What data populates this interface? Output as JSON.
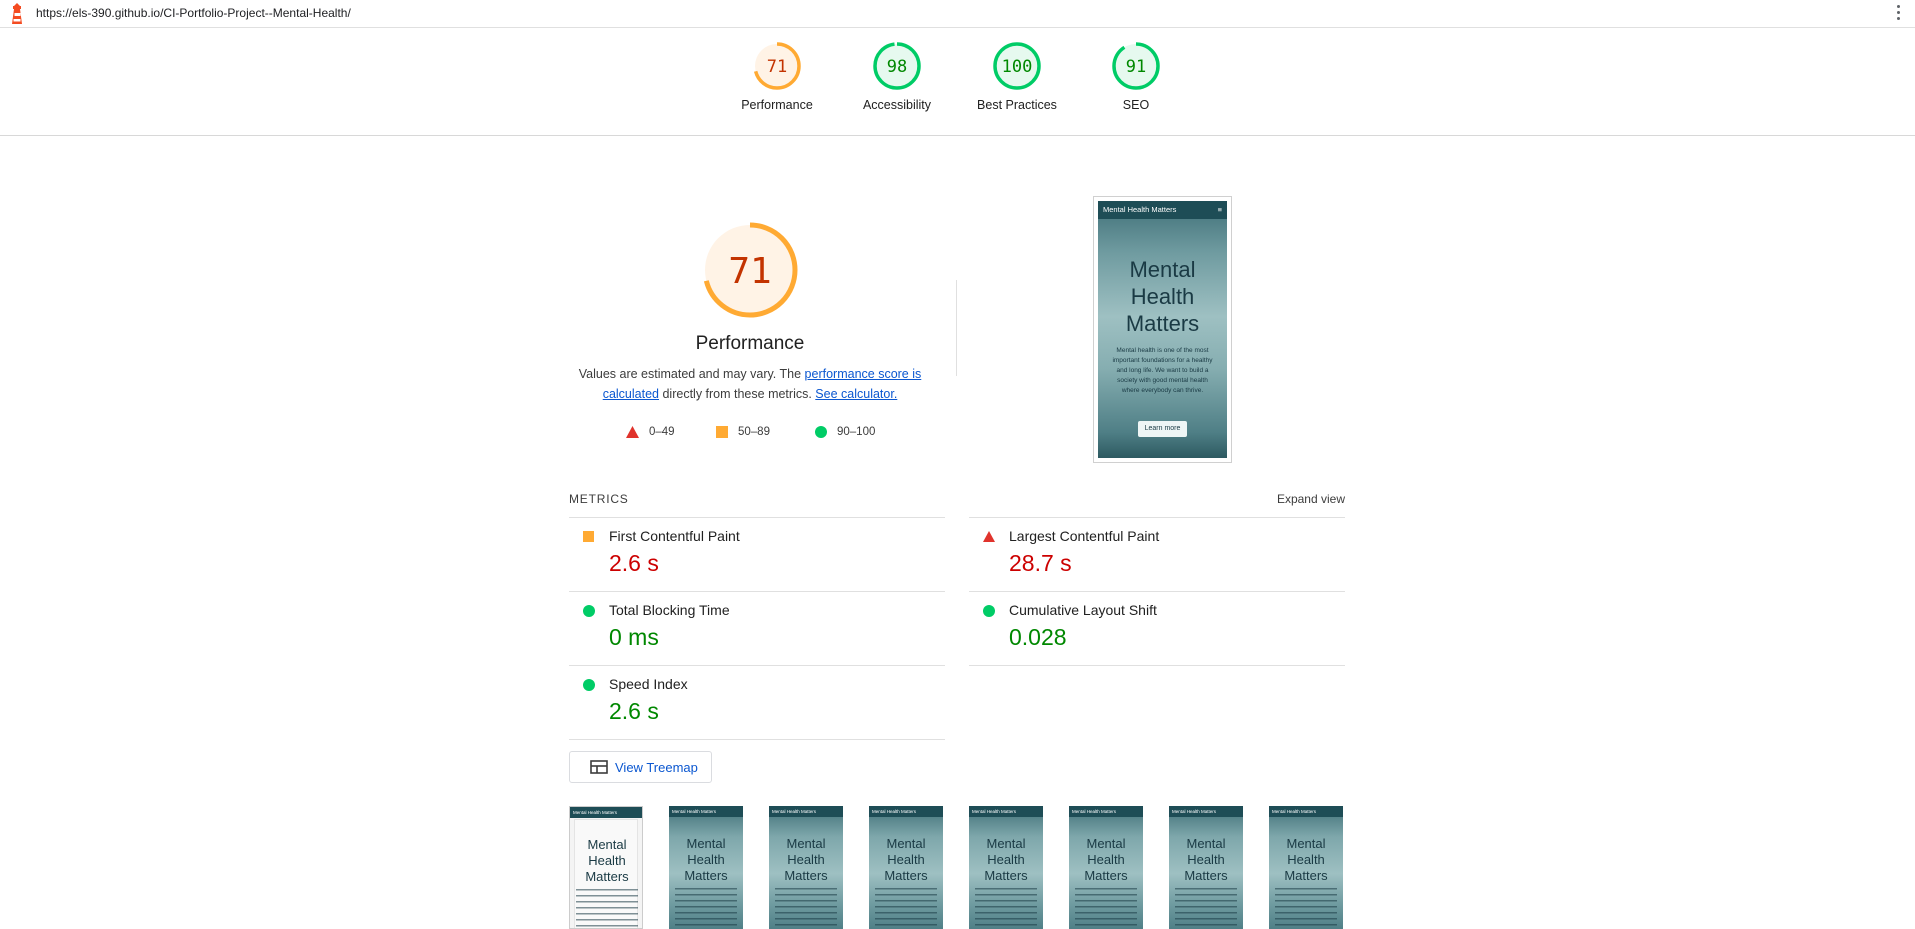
{
  "browser": {
    "url": "https://els-390.github.io/CI-Portfolio-Project--Mental-Health/"
  },
  "categories": [
    {
      "name": "Performance",
      "score": "71",
      "color": "#fa3",
      "text_color": "#c33300"
    },
    {
      "name": "Accessibility",
      "score": "98",
      "color": "#0c6",
      "text_color": "#080"
    },
    {
      "name": "Best Practices",
      "score": "100",
      "color": "#0c6",
      "text_color": "#080"
    },
    {
      "name": "SEO",
      "score": "91",
      "color": "#0c6",
      "text_color": "#080"
    }
  ],
  "performance": {
    "score": "71",
    "title": "Performance",
    "desc_prefix": "Values are estimated and may vary. The ",
    "desc_link1": "performance score is calculated",
    "desc_middle": " directly from these metrics. ",
    "desc_link2": "See calculator.",
    "legend": [
      "0–49",
      "50–89",
      "90–100"
    ]
  },
  "screenshot": {
    "nav_title": "Mental Health Matters",
    "hero": "Mental Health Matters",
    "text": "Mental health is one of the most important foundations for a healthy and long life. We want to build a society with good mental health where everybody can thrive.",
    "button": "Learn more"
  },
  "metrics": {
    "header": "METRICS",
    "expand_label": "Expand view",
    "items": [
      {
        "name": "First Contentful Paint",
        "value": "2.6 s",
        "rating": "average"
      },
      {
        "name": "Largest Contentful Paint",
        "value": "28.7 s",
        "rating": "fail"
      },
      {
        "name": "Total Blocking Time",
        "value": "0 ms",
        "rating": "pass"
      },
      {
        "name": "Cumulative Layout Shift",
        "value": "0.028",
        "rating": "pass"
      },
      {
        "name": "Speed Index",
        "value": "2.6 s",
        "rating": "pass"
      }
    ]
  },
  "treemap": {
    "label": "View Treemap"
  },
  "filmstrip": {
    "frame_title": "Mental Health Matters",
    "frame_hero": "Mental Health Matters",
    "count": 8
  },
  "colors": {
    "fail": "#c00",
    "average": "#fa3",
    "pass": "#0c6",
    "pass_text": "#080",
    "fail_text": "#c00"
  }
}
